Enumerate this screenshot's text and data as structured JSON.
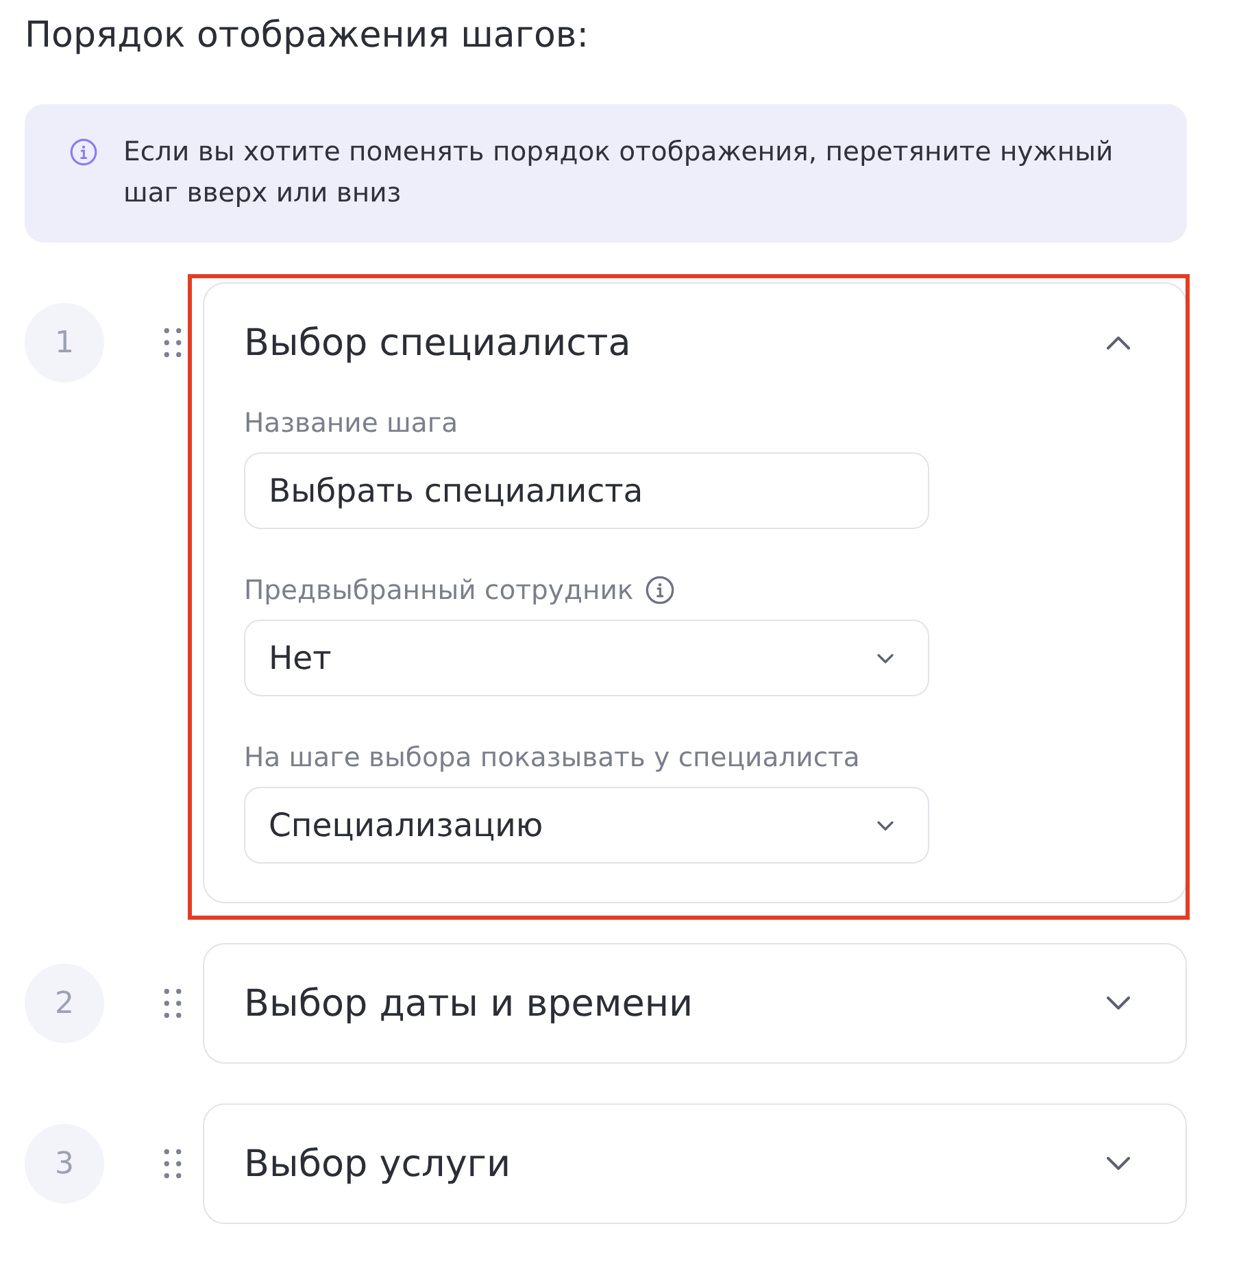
{
  "heading": "Порядок отображения шагов:",
  "notice": {
    "text": "Если вы хотите поменять порядок отображения, перетяните нужный шаг вверх или вниз"
  },
  "steps": [
    {
      "number": "1",
      "title": "Выбор специалиста",
      "expanded": true,
      "highlighted": true,
      "fields": [
        {
          "kind": "text",
          "label": "Название шага",
          "info": false,
          "value": "Выбрать специалиста"
        },
        {
          "kind": "select",
          "label": "Предвыбранный сотрудник",
          "info": true,
          "value": "Нет"
        },
        {
          "kind": "select",
          "label": "На шаге выбора показывать у специалиста",
          "info": false,
          "value": "Специализацию"
        }
      ]
    },
    {
      "number": "2",
      "title": "Выбор даты и времени",
      "expanded": false,
      "highlighted": false
    },
    {
      "number": "3",
      "title": "Выбор услуги",
      "expanded": false,
      "highlighted": false
    }
  ]
}
